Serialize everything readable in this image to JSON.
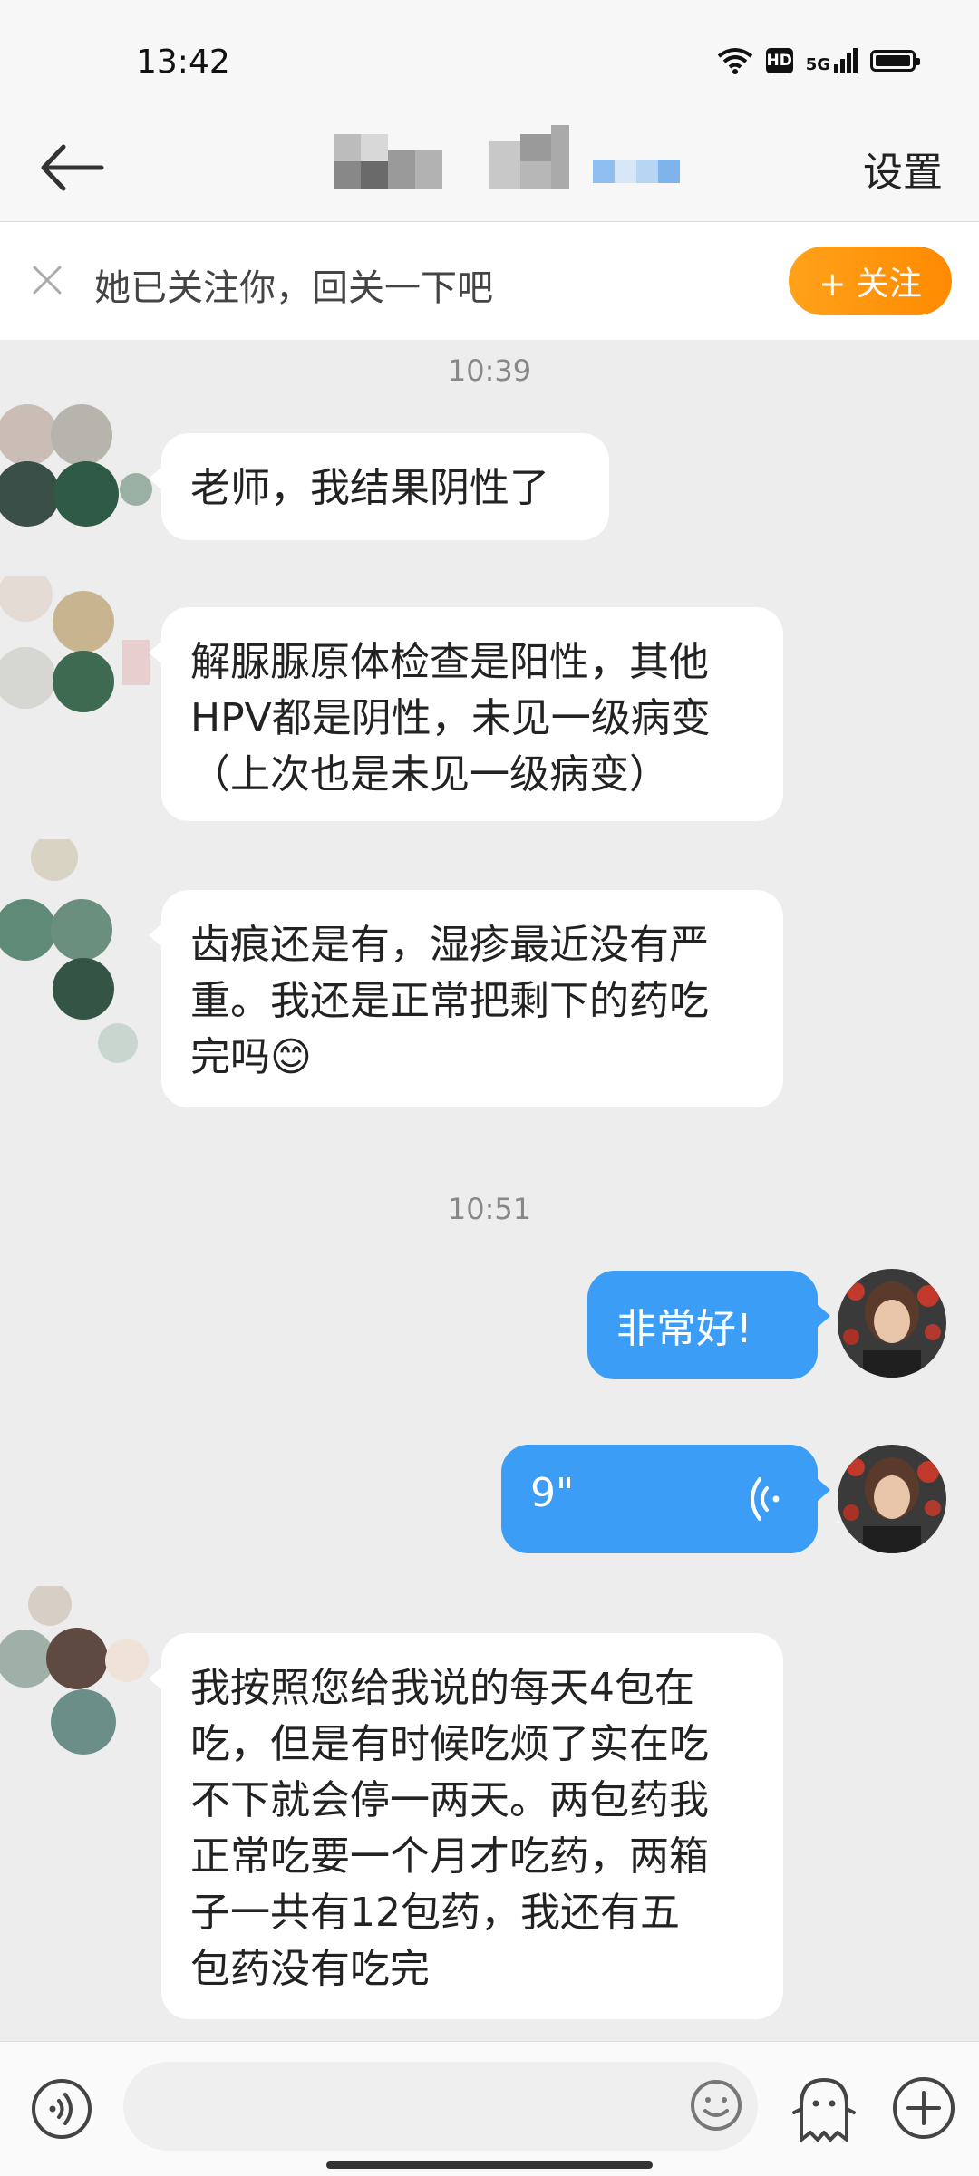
{
  "status_bar": {
    "time": "13:42",
    "network": "5G",
    "hd": "HD"
  },
  "header": {
    "settings_label": "设置"
  },
  "follow_bar": {
    "text": "她已关注你，回关一下吧",
    "button_label": "+ 关注"
  },
  "messages": [
    {
      "type": "timestamp",
      "text": "10:39"
    },
    {
      "type": "received",
      "lines": [
        "老师，我结果阴性了"
      ]
    },
    {
      "type": "received",
      "lines": [
        "解脲脲原体检查是阳性，其他",
        "HPV都是阴性，未见一级病变",
        "（上次也是未见一级病变）"
      ]
    },
    {
      "type": "received",
      "lines": [
        "齿痕还是有，湿疹最近没有严",
        "重。我还是正常把剩下的药吃",
        "完吗"
      ],
      "emoji": "😊"
    },
    {
      "type": "timestamp",
      "text": "10:51"
    },
    {
      "type": "sent",
      "text": "非常好!"
    },
    {
      "type": "sent_voice",
      "duration": "9\""
    },
    {
      "type": "received",
      "lines": [
        "我按照您给我说的每天4包在",
        "吃，但是有时候吃烦了实在吃",
        "不下就会停一两天。两包药我",
        "正常吃要一个月才吃药，两箱",
        "子一共有12包药，我还有五",
        "包药没有吃完"
      ]
    }
  ],
  "icons": {
    "back": "back-arrow-icon",
    "close": "close-icon",
    "voice": "voice-input-icon",
    "emoji": "emoji-icon",
    "sticker": "sticker-icon",
    "plus": "plus-icon"
  },
  "colors": {
    "sent_bubble": "#3b9df5",
    "follow_button": "#ff9a10",
    "background": "#ededed"
  }
}
